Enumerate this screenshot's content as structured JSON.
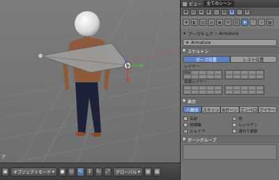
{
  "viewport": {
    "corner_label": "ア",
    "header": {
      "mode_label": "オブジェクトモード",
      "pivot_label": "グローバル"
    }
  },
  "panel": {
    "top_bar": {
      "view_label": "ビュー",
      "scene_label": "全てのシーン"
    },
    "breadcrumb": {
      "armature_label": "アーマチュア",
      "object_label": "Armature"
    },
    "name_field": {
      "value": "Armature"
    },
    "skeleton": {
      "title": "スケルトン",
      "pose_position": "ポーズ位置",
      "rest_position": "レスト位置",
      "layers_label": "レイヤー:",
      "protected_layers_label": "保護レイヤー:"
    },
    "display": {
      "title": "表示",
      "tabs": [
        "八面体",
        "スティッ",
        "Bボーン",
        "エンベロ",
        "ワイヤー"
      ],
      "checks": [
        {
          "label": "名前",
          "checked": false
        },
        {
          "label": "色",
          "checked": true
        },
        {
          "label": "座標軸",
          "checked": false
        },
        {
          "label": "レントゲン",
          "checked": false
        },
        {
          "label": "シェイプ",
          "checked": true
        },
        {
          "label": "遅れて更新",
          "checked": false
        }
      ]
    },
    "bone_groups": {
      "title": "ボーングループ"
    }
  },
  "colors": {
    "accent": "#5c80c2",
    "panel_bg": "#727272",
    "viewport_bg": "#747474"
  }
}
